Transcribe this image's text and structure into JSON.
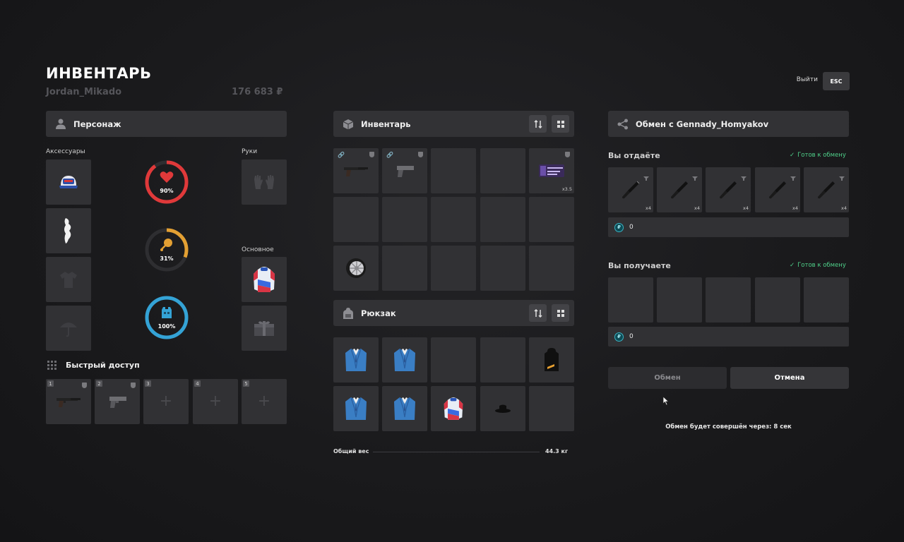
{
  "header": {
    "title": "ИНВЕНТАРЬ",
    "player_name": "Jordan_Mikado",
    "money": "176 683 ₽",
    "exit_label": "Выйти",
    "esc_label": "ESC"
  },
  "character": {
    "title": "Персонаж",
    "accessories_label": "Аксессуары",
    "hands_label": "Руки",
    "main_label": "Основное",
    "stats": [
      {
        "name": "health",
        "percent": 90,
        "label": "90%",
        "color": "#e0393a",
        "icon": "heart-icon"
      },
      {
        "name": "hunger",
        "percent": 31,
        "label": "31%",
        "color": "#e3a033",
        "icon": "food-icon"
      },
      {
        "name": "armor",
        "percent": 100,
        "label": "100%",
        "color": "#34a3d6",
        "icon": "armor-icon"
      }
    ]
  },
  "quick_access": {
    "title": "Быстрый доступ",
    "slots": [
      "1",
      "2",
      "3",
      "4",
      "5"
    ]
  },
  "inventory": {
    "title": "Инвентарь",
    "item_count_label": "x3.5",
    "backpack_title": "Рюкзак",
    "weight_label": "Общий вес",
    "weight_value": "44.3 кг"
  },
  "exchange": {
    "title": "Обмен с Gennady_Homyakov",
    "you_give_label": "Вы отдаёте",
    "you_get_label": "Вы получаете",
    "ready_label_give": "Готов к обмену",
    "ready_label_get": "Готов к обмену",
    "give_item_count": "x4",
    "give_money": "0",
    "get_money": "0",
    "exchange_button": "Обмен",
    "cancel_button": "Отмена",
    "timer_text": "Обмен будет совершён через: 8 сек"
  },
  "colors": {
    "health": "#e0393a",
    "hunger": "#e3a033",
    "armor": "#34a3d6",
    "ready": "#4fd18a",
    "coin": "#3bb2c2"
  }
}
